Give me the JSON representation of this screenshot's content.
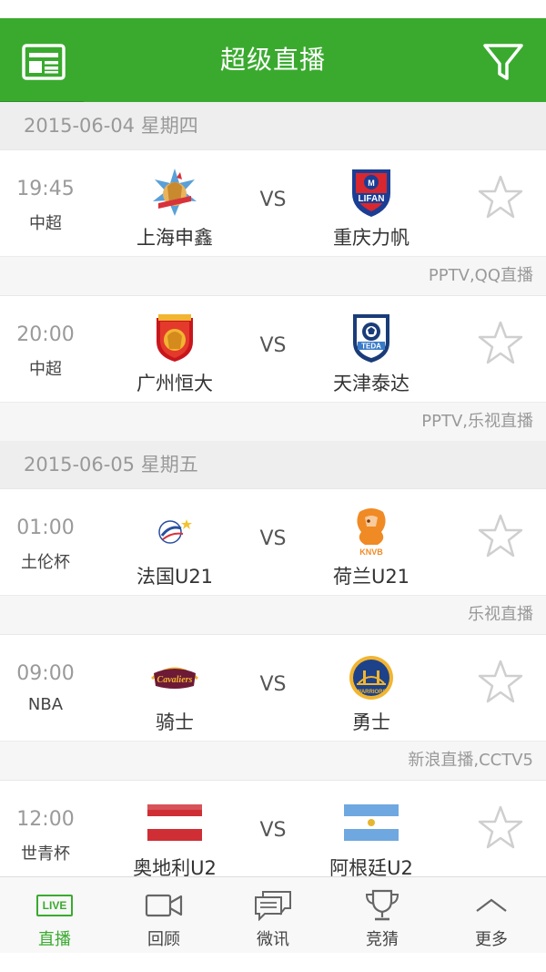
{
  "header": {
    "title": "超级直播",
    "news_icon": "news-icon",
    "filter_icon": "filter-icon",
    "accent": "#3aaa2f"
  },
  "sections": [
    {
      "date": "2015-06-04 星期四",
      "matches": [
        {
          "time": "19:45",
          "league": "中超",
          "home": "上海申鑫",
          "away": "重庆力帆",
          "vs": "VS",
          "channels": "PPTV,QQ直播"
        },
        {
          "time": "20:00",
          "league": "中超",
          "home": "广州恒大",
          "away": "天津泰达",
          "vs": "VS",
          "channels": "PPTV,乐视直播"
        }
      ]
    },
    {
      "date": "2015-06-05 星期五",
      "matches": [
        {
          "time": "01:00",
          "league": "土伦杯",
          "home": "法国U21",
          "away": "荷兰U21",
          "vs": "VS",
          "channels": "乐视直播"
        },
        {
          "time": "09:00",
          "league": "NBA",
          "home": "骑士",
          "away": "勇士",
          "vs": "VS",
          "channels": "新浪直播,CCTV5"
        },
        {
          "time": "12:00",
          "league": "世青杯",
          "home": "奥地利U2",
          "away": "阿根廷U2",
          "vs": "VS",
          "channels": ""
        }
      ]
    }
  ],
  "logos": {
    "lifan_text": "LIFAN",
    "teda_text": "TEDA",
    "knvb_text": "KNVB",
    "cavs_text": "Cavaliers",
    "warriors_text": "WARRIORS"
  },
  "tabs": [
    {
      "label": "直播",
      "icon": "live-icon",
      "icon_text": "LIVE",
      "active": true
    },
    {
      "label": "回顾",
      "icon": "video-camera-icon",
      "active": false
    },
    {
      "label": "微讯",
      "icon": "chat-bubbles-icon",
      "active": false
    },
    {
      "label": "竞猜",
      "icon": "trophy-icon",
      "active": false
    },
    {
      "label": "更多",
      "icon": "chevron-up-icon",
      "active": false
    }
  ]
}
